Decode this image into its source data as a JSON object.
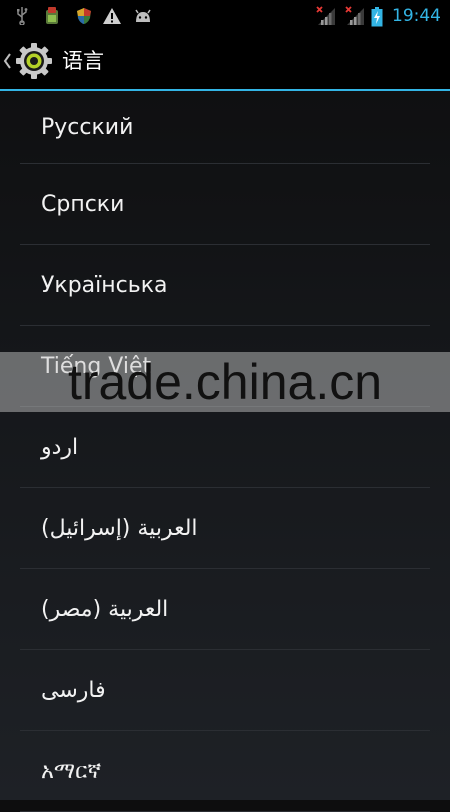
{
  "status_bar": {
    "time": "19:44",
    "icons": [
      "usb-icon",
      "app-notification-icon",
      "shield-notification-icon",
      "warning-icon",
      "android-icon",
      "signal-no-service-icon",
      "signal-no-service-icon",
      "battery-charging-icon"
    ],
    "accent_color": "#33b5e5"
  },
  "action_bar": {
    "title": "语言",
    "icon": "settings-gear-icon",
    "divider_color": "#33b5e5"
  },
  "languages": [
    {
      "label": "Русский"
    },
    {
      "label": "Српски"
    },
    {
      "label": "Українська"
    },
    {
      "label": "Tiếng Việt"
    },
    {
      "label": "اردو"
    },
    {
      "label": "العربية (إسرائيل)"
    },
    {
      "label": "العربية (مصر)"
    },
    {
      "label": "فارسی"
    },
    {
      "label": "አማርኛ"
    }
  ],
  "watermark": {
    "text": "trade.china.cn"
  }
}
